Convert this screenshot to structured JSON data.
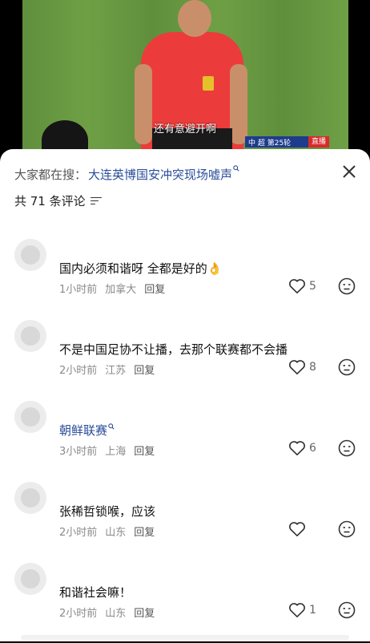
{
  "video": {
    "subtitle": "还有意避开啊",
    "scorebar_league": "中 超 第25轮",
    "scorebar_live": "直播"
  },
  "sheet": {
    "search_prefix": "大家都在搜：",
    "search_query": "大连英博国安冲突现场嘘声",
    "comment_count": "共 71 条评论"
  },
  "comments": [
    {
      "text": "国内必须和谐呀 全都是好的👌",
      "time": "1小时前",
      "location": "加拿大",
      "reply": "回复",
      "likes": "5",
      "is_link": false
    },
    {
      "text": "不是中国足协不让播，去那个联赛都不会播",
      "time": "2小时前",
      "location": "江苏",
      "reply": "回复",
      "likes": "8",
      "is_link": false
    },
    {
      "text": "朝鲜联赛",
      "time": "3小时前",
      "location": "上海",
      "reply": "回复",
      "likes": "6",
      "is_link": true
    },
    {
      "text": "张稀哲锁喉，应该",
      "time": "2小时前",
      "location": "山东",
      "reply": "回复",
      "likes": "",
      "is_link": false
    },
    {
      "text": "和谐社会嘛！",
      "time": "2小时前",
      "location": "山东",
      "reply": "回复",
      "likes": "1",
      "is_link": false
    }
  ],
  "colors": {
    "link": "#2a4d9a",
    "meta": "#8a8a8a",
    "referee_shirt": "#ec3b3b",
    "pitch": "#6f9f45"
  }
}
